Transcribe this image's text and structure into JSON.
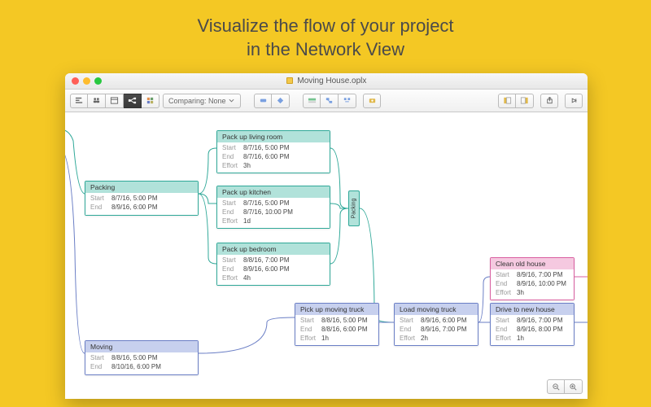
{
  "tagline_l1": "Visualize the flow of your project",
  "tagline_l2": "in the Network View",
  "window": {
    "title": "Moving House.oplx"
  },
  "toolbar": {
    "comparing": "Comparing: None"
  },
  "labels": {
    "start": "Start",
    "end": "End",
    "effort": "Effort"
  },
  "nodes": {
    "packing": {
      "title": "Packing",
      "start": "8/7/16, 5:00 PM",
      "end": "8/9/16, 6:00 PM"
    },
    "living": {
      "title": "Pack up living room",
      "start": "8/7/16, 5:00 PM",
      "end": "8/7/16, 6:00 PM",
      "effort": "3h"
    },
    "kitchen": {
      "title": "Pack up kitchen",
      "start": "8/7/16, 5:00 PM",
      "end": "8/7/16, 10:00 PM",
      "effort": "1d"
    },
    "bedroom": {
      "title": "Pack up bedroom",
      "start": "8/8/16, 7:00 PM",
      "end": "8/9/16, 6:00 PM",
      "effort": "4h"
    },
    "moving": {
      "title": "Moving",
      "start": "8/8/16, 5:00 PM",
      "end": "8/10/16, 6:00 PM"
    },
    "pickup": {
      "title": "Pick up moving truck",
      "start": "8/8/16, 5:00 PM",
      "end": "8/8/16, 6:00 PM",
      "effort": "1h"
    },
    "load": {
      "title": "Load moving truck",
      "start": "8/9/16, 6:00 PM",
      "end": "8/9/16, 7:00 PM",
      "effort": "2h"
    },
    "clean": {
      "title": "Clean old house",
      "start": "8/9/16, 7:00 PM",
      "end": "8/9/16, 10:00 PM",
      "effort": "3h"
    },
    "drive": {
      "title": "Drive to new house",
      "start": "8/9/16, 7:00 PM",
      "end": "8/9/16, 8:00 PM",
      "effort": "1h"
    },
    "vgroup": {
      "title": "Packing"
    }
  }
}
